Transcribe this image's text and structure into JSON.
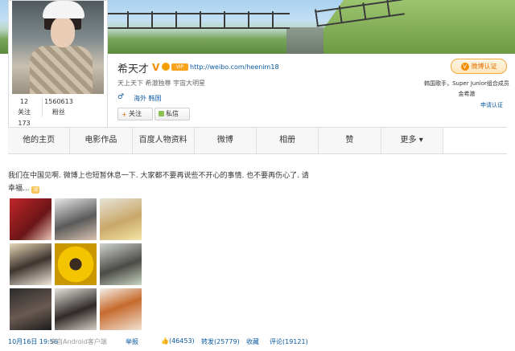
{
  "profile": {
    "name": "希天才",
    "verified_mark": "V",
    "member_badge": "VIP",
    "url": "http://weibo.com/heenim18",
    "tagline": "天上天下 希澈独尊 宇宙大明星",
    "gender_symbol": "♂",
    "location": "海外 韩国",
    "follow_label": "关注",
    "message_label": "私信",
    "stats": [
      {
        "value": "12",
        "label": "关注"
      },
      {
        "value": "1560613",
        "label": "粉丝"
      },
      {
        "value": "173",
        "label": ""
      }
    ]
  },
  "verification": {
    "button_label": "微博认证",
    "description": "韩国歌手，Super Junior组合成员金希澈",
    "apply_link": "申请认证"
  },
  "tabs": [
    "他的主页",
    "电影作品",
    "百度人物资料",
    "微博",
    "相册",
    "赞",
    "更多 ▾"
  ],
  "post": {
    "text": "我们在中国见啊. 微博上也短暂休息一下. 大家都不要再说些不开心的事情. 也不要再伤心了. 请幸福...",
    "time": "10月16日 19:56",
    "source": "来自Android客户端",
    "report": "举报",
    "like": "(46453)",
    "repost": "转发(25779)",
    "favorite": "收藏",
    "comment": "评论(19121)"
  },
  "icons": {
    "crown": "crown-icon",
    "verify": "verify-v-icon",
    "emoticon": "emoticon-icon",
    "like": "thumbs-up-icon"
  },
  "colors": {
    "link": "#0a5aa0",
    "verify_orange": "#f28e00"
  }
}
